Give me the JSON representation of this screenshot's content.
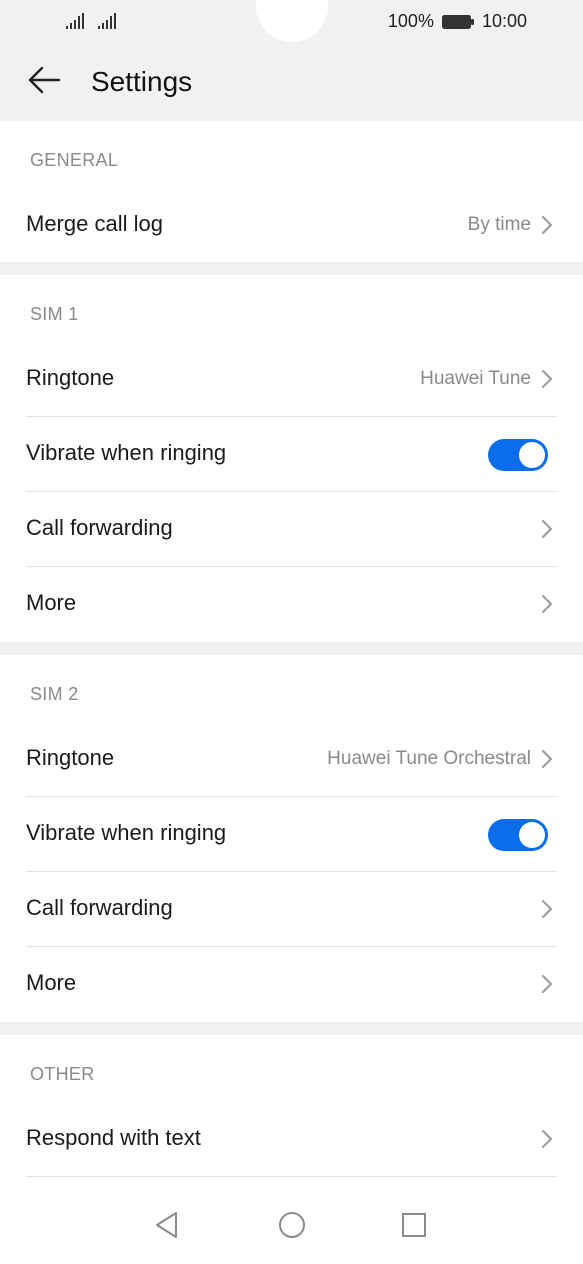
{
  "status_bar": {
    "battery_percent": "100%",
    "time": "10:00",
    "icons": [
      "signal-sim1-icon",
      "signal-sim2-icon",
      "battery-icon"
    ]
  },
  "header": {
    "title": "Settings",
    "back_icon": "back-arrow-icon"
  },
  "sections": {
    "general": {
      "title": "GENERAL",
      "merge_call_log": {
        "label": "Merge call log",
        "value": "By time"
      }
    },
    "sim1": {
      "title": "SIM 1",
      "ringtone": {
        "label": "Ringtone",
        "value": "Huawei Tune"
      },
      "vibrate": {
        "label": "Vibrate when ringing",
        "on": true
      },
      "call_forwarding": {
        "label": "Call forwarding"
      },
      "more": {
        "label": "More"
      }
    },
    "sim2": {
      "title": "SIM 2",
      "ringtone": {
        "label": "Ringtone",
        "value": "Huawei Tune Orchestral"
      },
      "vibrate": {
        "label": "Vibrate when ringing",
        "on": true
      },
      "call_forwarding": {
        "label": "Call forwarding"
      },
      "more": {
        "label": "More"
      }
    },
    "other": {
      "title": "OTHER",
      "respond_with_text": {
        "label": "Respond with text"
      }
    }
  },
  "nav_bar": {
    "icons": [
      "nav-back-icon",
      "nav-home-icon",
      "nav-recents-icon"
    ]
  },
  "colors": {
    "accent": "#0a6eea",
    "background": "#f1f1f1",
    "card": "#ffffff",
    "secondary_text": "#8a8a8a"
  }
}
